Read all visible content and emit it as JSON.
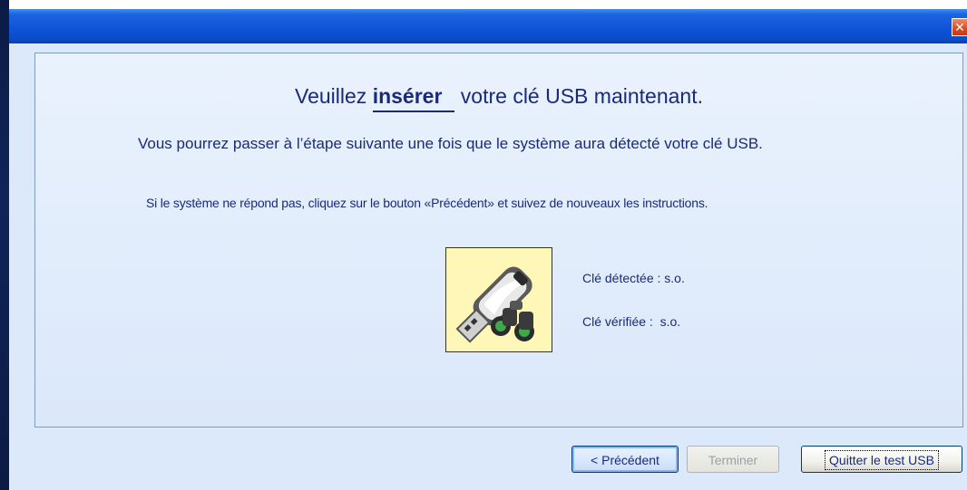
{
  "dialog": {
    "heading_prefix": "Veuillez ",
    "heading_emphasis": "insérer",
    "heading_suffix": " votre clé USB maintenant.",
    "instruction": "Vous pourrez passer à l’étape suivante une fois que le système aura détecté votre clé USB.",
    "note": "Si le système ne répond pas, cliquez sur le bouton «Précédent» et suivez de nouveaux les instructions.",
    "status": {
      "detected": "Clé détectée : s.o.",
      "verified": "Clé vérifiée :  s.o."
    }
  },
  "buttons": {
    "previous": "< Précédent",
    "finish": "Terminer",
    "quit": "Quitter le test USB"
  },
  "icons": {
    "close": "close-icon",
    "illustration": "usb-key-binoculars-icon"
  },
  "colors": {
    "titlebar": "#0f55d8",
    "panel": "#dce9fa",
    "text": "#1a2a7a",
    "illustration_bg": "#fff7b8"
  }
}
